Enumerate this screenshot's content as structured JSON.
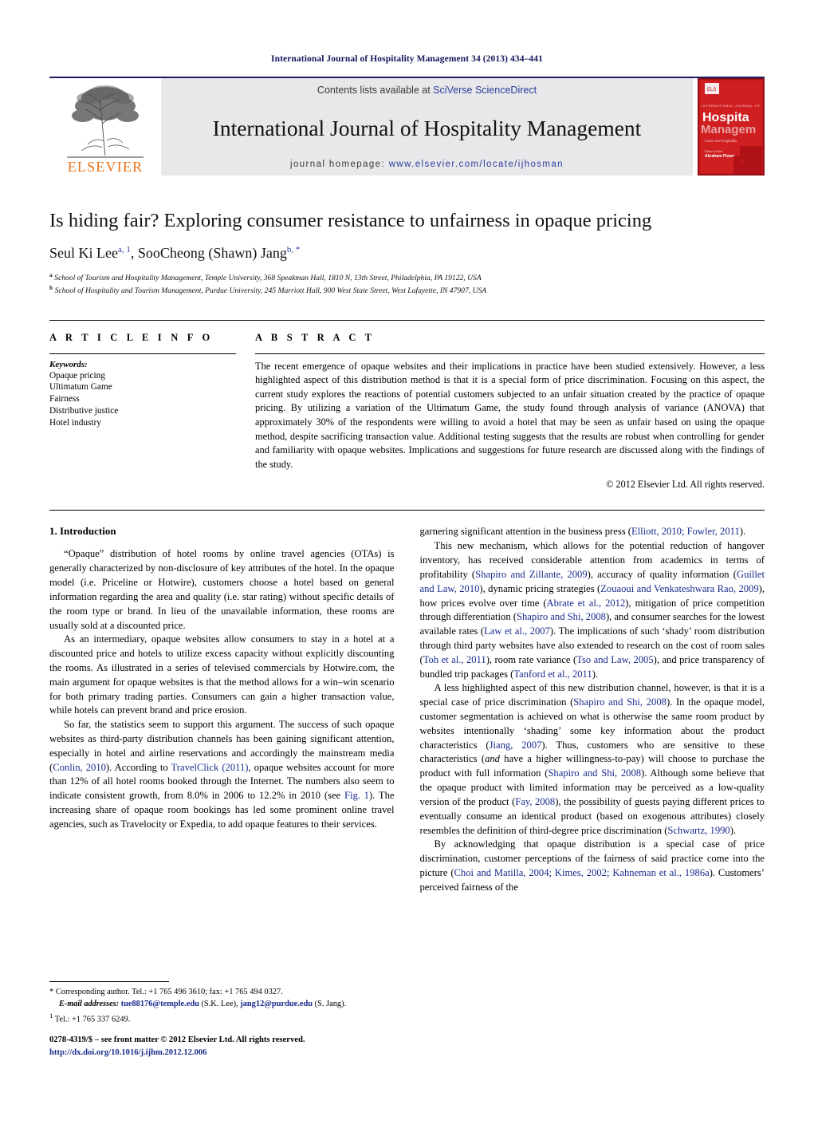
{
  "running_head": "International Journal of Hospitality Management 34 (2013) 434–441",
  "masthead": {
    "publisher_name": "ELSEVIER",
    "contents_prefix": "Contents lists available at ",
    "contents_link": "SciVerse ScienceDirect",
    "journal_name": "International Journal of Hospitality Management",
    "homepage_prefix": "journal homepage:",
    "homepage_url": "www.elsevier.com/locate/ijhosman",
    "cover": {
      "kicker": "INTERNATIONAL JOURNAL OF",
      "line1": "Hospitality",
      "line2": "Management",
      "tagline": "home and hospitality",
      "byline_label": "Editor-in-Chief",
      "byline_name": "Abraham Pizam"
    },
    "accent_red": "#c4161c",
    "accent_blue": "#2a3c9c",
    "band_gray": "#e8e8ea"
  },
  "title": "Is hiding fair? Exploring consumer resistance to unfairness in opaque pricing",
  "authors": [
    {
      "name": "Seul Ki Lee",
      "marks": "a, 1"
    },
    {
      "name": "SooCheong (Shawn) Jang",
      "marks": "b, *"
    }
  ],
  "affiliations": [
    {
      "mark": "a",
      "text": "School of Tourism and Hospitality Management, Temple University, 368 Speakman Hall, 1810 N, 13th Street, Philadelphia, PA 19122, USA"
    },
    {
      "mark": "b",
      "text": "School of Hospitality and Tourism Management, Purdue University, 245 Marriott Hall, 900 West State Street, West Lafayette, IN 47907, USA"
    }
  ],
  "article_info": {
    "heading": "A R T I C L E   I N F O",
    "keywords_label": "Keywords:",
    "keywords": [
      "Opaque pricing",
      "Ultimatum Game",
      "Fairness",
      "Distributive justice",
      "Hotel industry"
    ]
  },
  "abstract": {
    "heading": "A B S T R A C T",
    "text": "The recent emergence of opaque websites and their implications in practice have been studied extensively. However, a less highlighted aspect of this distribution method is that it is a special form of price discrimination. Focusing on this aspect, the current study explores the reactions of potential customers subjected to an unfair situation created by the practice of opaque pricing. By utilizing a variation of the Ultimatum Game, the study found through analysis of variance (ANOVA) that approximately 30% of the respondents were willing to avoid a hotel that may be seen as unfair based on using the opaque method, despite sacrificing transaction value. Additional testing suggests that the results are robust when controlling for gender and familiarity with opaque websites. Implications and suggestions for future research are discussed along with the findings of the study.",
    "copyright": "© 2012 Elsevier Ltd. All rights reserved."
  },
  "body": {
    "section_title": "1. Introduction",
    "left_paragraphs": [
      "“Opaque” distribution of hotel rooms by online travel agencies (OTAs) is generally characterized by non-disclosure of key attributes of the hotel. In the opaque model (i.e. Priceline or Hotwire), customers choose a hotel based on general information regarding the area and quality (i.e. star rating) without specific details of the room type or brand. In lieu of the unavailable information, these rooms are usually sold at a discounted price.",
      "As an intermediary, opaque websites allow consumers to stay in a hotel at a discounted price and hotels to utilize excess capacity without explicitly discounting the rooms. As illustrated in a series of televised commercials by Hotwire.com, the main argument for opaque websites is that the method allows for a win–win scenario for both primary trading parties. Consumers can gain a higher transaction value, while hotels can prevent brand and price erosion."
    ],
    "left_paragraph_3_parts": [
      {
        "t": "So far, the statistics seem to support this argument. The success of such opaque websites as third-party distribution channels has been gaining significant attention, especially in hotel and airline reservations and accordingly the mainstream media (",
        "ref": false
      },
      {
        "t": "Conlin, 2010",
        "ref": true
      },
      {
        "t": "). According to ",
        "ref": false
      },
      {
        "t": "TravelClick (2011)",
        "ref": true
      },
      {
        "t": ", opaque websites account for more than 12% of all hotel rooms booked through the Internet. The numbers also seem to indicate consistent growth, from 8.0% in 2006 to 12.2% in 2010 (see ",
        "ref": false
      },
      {
        "t": "Fig. 1",
        "ref": true
      },
      {
        "t": "). The increasing share of opaque room bookings has led some prominent online travel agencies, such as Travelocity or Expedia, to add opaque features to their services.",
        "ref": false
      }
    ],
    "right_paragraph_1_parts": [
      {
        "t": "garnering significant attention in the business press (",
        "ref": false
      },
      {
        "t": "Elliott, 2010; Fowler, 2011",
        "ref": true
      },
      {
        "t": ").",
        "ref": false
      }
    ],
    "right_paragraph_2_parts": [
      {
        "t": "This new mechanism, which allows for the potential reduction of hangover inventory, has received considerable attention from academics in terms of profitability (",
        "ref": false
      },
      {
        "t": "Shapiro and Zillante, 2009",
        "ref": true
      },
      {
        "t": "), accuracy of quality information (",
        "ref": false
      },
      {
        "t": "Guillet and Law, 2010",
        "ref": true
      },
      {
        "t": "), dynamic pricing strategies (",
        "ref": false
      },
      {
        "t": "Zouaoui and Venkateshwara Rao, 2009",
        "ref": true
      },
      {
        "t": "), how prices evolve over time (",
        "ref": false
      },
      {
        "t": "Abrate et al., 2012",
        "ref": true
      },
      {
        "t": "), mitigation of price competition through differentiation (",
        "ref": false
      },
      {
        "t": "Shapiro and Shi, 2008",
        "ref": true
      },
      {
        "t": "), and consumer searches for the lowest available rates (",
        "ref": false
      },
      {
        "t": "Law et al., 2007",
        "ref": true
      },
      {
        "t": "). The implications of such ‘shady’ room distribution through third party websites have also extended to research on the cost of room sales (",
        "ref": false
      },
      {
        "t": "Toh et al., 2011",
        "ref": true
      },
      {
        "t": "), room rate variance (",
        "ref": false
      },
      {
        "t": "Tso and Law, 2005",
        "ref": true
      },
      {
        "t": "), and price transparency of bundled trip packages (",
        "ref": false
      },
      {
        "t": "Tanford et al., 2011",
        "ref": true
      },
      {
        "t": ").",
        "ref": false
      }
    ],
    "right_paragraph_3_parts": [
      {
        "t": "A less highlighted aspect of this new distribution channel, however, is that it is a special case of price discrimination (",
        "ref": false
      },
      {
        "t": "Shapiro and Shi, 2008",
        "ref": true
      },
      {
        "t": "). In the opaque model, customer segmentation is achieved on what is otherwise the same room product by websites intentionally ‘shading’ some key information about the product characteristics (",
        "ref": false
      },
      {
        "t": "Jiang, 2007",
        "ref": true
      },
      {
        "t": "). Thus, customers who are sensitive to these characteristics (",
        "ref": false
      },
      {
        "t": "and",
        "ref": false,
        "italic": true
      },
      {
        "t": " have a higher willingness-to-pay) will choose to purchase the product with full information (",
        "ref": false
      },
      {
        "t": "Shapiro and Shi, 2008",
        "ref": true
      },
      {
        "t": "). Although some believe that the opaque product with limited information may be perceived as a low-quality version of the product (",
        "ref": false
      },
      {
        "t": "Fay, 2008",
        "ref": true
      },
      {
        "t": "), the possibility of guests paying different prices to eventually consume an identical product (based on exogenous attributes) closely resembles the definition of third-degree price discrimination (",
        "ref": false
      },
      {
        "t": "Schwartz, 1990",
        "ref": true
      },
      {
        "t": ").",
        "ref": false
      }
    ],
    "right_paragraph_4_parts": [
      {
        "t": "By acknowledging that opaque distribution is a special case of price discrimination, customer perceptions of the fairness of said practice come into the picture (",
        "ref": false
      },
      {
        "t": "Choi and Matilla, 2004; Kimes, 2002; Kahneman et al., 1986a",
        "ref": true
      },
      {
        "t": "). Customers’ perceived fairness of the",
        "ref": false
      }
    ]
  },
  "footnotes": {
    "corresponding": {
      "mark": "*",
      "text": "Corresponding author. Tel.: +1 765 496 3610; fax: +1 765 494 0327."
    },
    "email_label": "E-mail addresses:",
    "email_1": "tue88176@temple.edu",
    "email_1_who": " (S.K. Lee),",
    "email_2": "jang12@purdue.edu",
    "email_2_who": " (S. Jang).",
    "note_1_mark": "1",
    "note_1_text": "Tel.: +1 765 337 6249."
  },
  "imprint": {
    "line1": "0278-4319/$ – see front matter © 2012 Elsevier Ltd. All rights reserved.",
    "doi": "http://dx.doi.org/10.1016/j.ijhm.2012.12.006"
  }
}
